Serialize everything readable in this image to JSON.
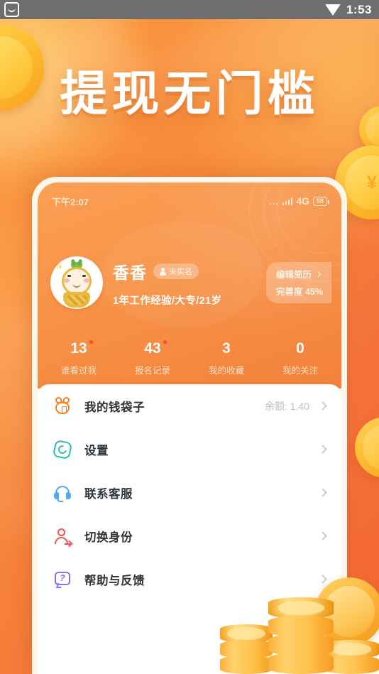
{
  "android_status_bar": {
    "app_icon": "inbox-app-icon",
    "wifi_icon": "wifi-icon",
    "time": "1:53"
  },
  "poster": {
    "headline": "提现无门槛",
    "background_color": "#f7853a",
    "accent_color": "#ffc233"
  },
  "phone": {
    "status_bar": {
      "time": "下午2:07",
      "dots": "...",
      "network": "4G",
      "battery": "58"
    },
    "profile": {
      "avatar_name": "user-avatar-cartoon",
      "name": "香香",
      "verify_badge": "未实名",
      "subtitle": "1年工作经验/大专/21岁",
      "resume_button": {
        "label": "编辑简历",
        "completion": "完善度 45%"
      }
    },
    "stats": [
      {
        "value": "13",
        "label": "谁看过我",
        "has_dot": true
      },
      {
        "value": "43",
        "label": "报名记录",
        "has_dot": true
      },
      {
        "value": "3",
        "label": "我的收藏",
        "has_dot": false
      },
      {
        "value": "0",
        "label": "我的关注",
        "has_dot": false
      }
    ],
    "menu": [
      {
        "icon": "money-bag-icon",
        "label": "我的钱袋子",
        "value": "余额: 1.40",
        "color": "#f58220"
      },
      {
        "icon": "gear-icon",
        "label": "设置",
        "value": "",
        "color": "#2bbfa3"
      },
      {
        "icon": "headset-icon",
        "label": "联系客服",
        "value": "",
        "color": "#4aa8f0"
      },
      {
        "icon": "switch-user-icon",
        "label": "切换身份",
        "value": "",
        "color": "#f0564a"
      },
      {
        "icon": "help-question-icon",
        "label": "帮助与反馈",
        "value": "",
        "color": "#8b6ef2"
      }
    ]
  }
}
